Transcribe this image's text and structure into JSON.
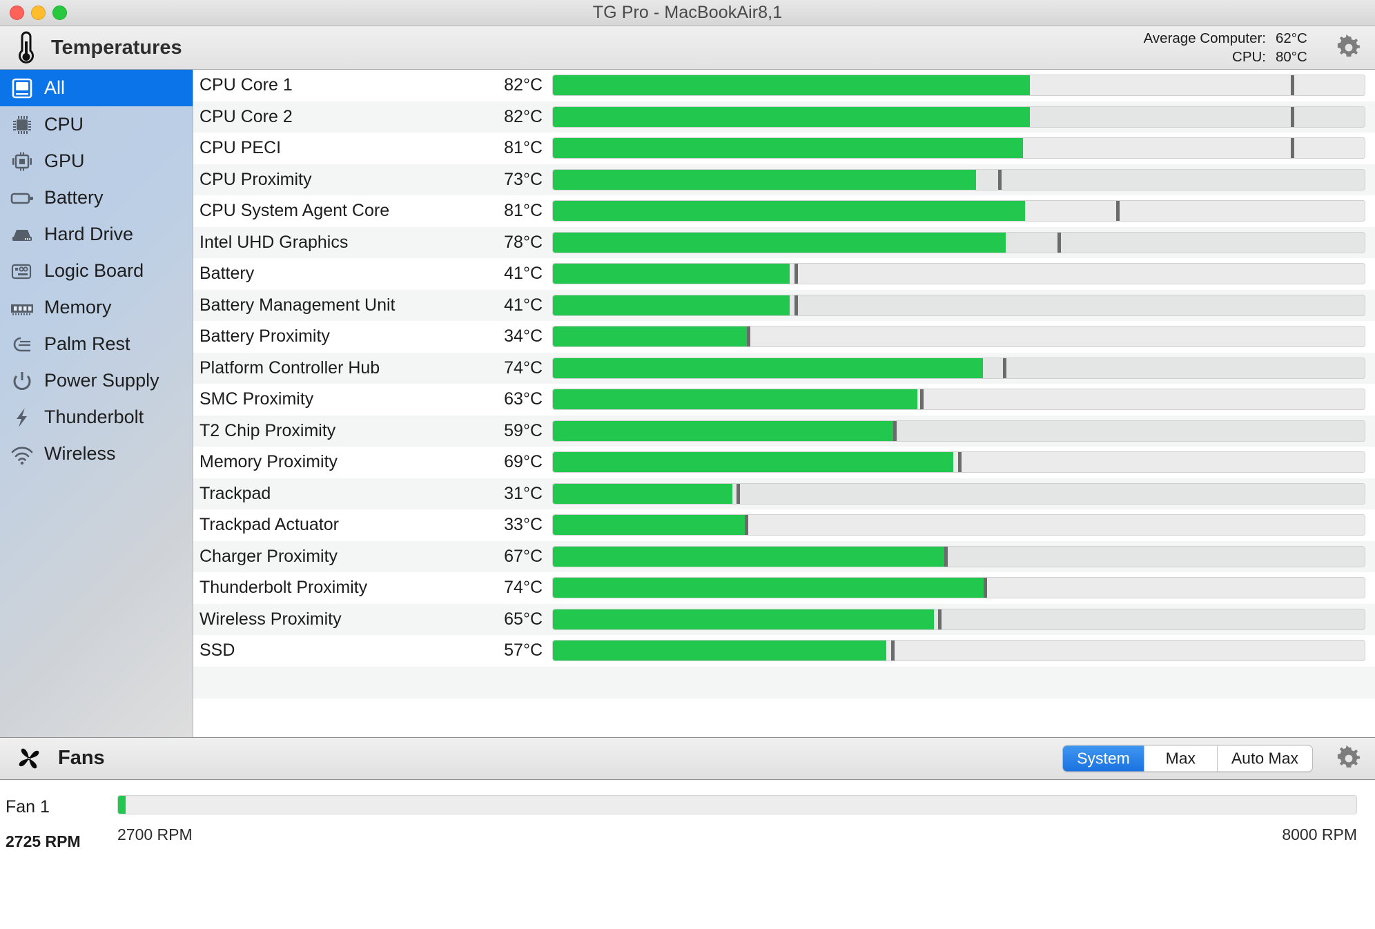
{
  "window": {
    "title": "TG Pro - MacBookAir8,1",
    "traffic_lights": [
      "close-button",
      "minimize-button",
      "zoom-button"
    ]
  },
  "temps_header": {
    "icon": "thermometer-icon",
    "title": "Temperatures",
    "summary": [
      {
        "label": "Average Computer:",
        "value": "62°C"
      },
      {
        "label": "CPU:",
        "value": "80°C"
      }
    ],
    "settings_icon": "gear-icon"
  },
  "sidebar": {
    "items": [
      {
        "label": "All",
        "icon": "computer-icon",
        "selected": true
      },
      {
        "label": "CPU",
        "icon": "cpu-chip-icon",
        "selected": false
      },
      {
        "label": "GPU",
        "icon": "gpu-chip-icon",
        "selected": false
      },
      {
        "label": "Battery",
        "icon": "battery-icon",
        "selected": false
      },
      {
        "label": "Hard Drive",
        "icon": "hard-drive-icon",
        "selected": false
      },
      {
        "label": "Logic Board",
        "icon": "logic-board-icon",
        "selected": false
      },
      {
        "label": "Memory",
        "icon": "memory-ram-icon",
        "selected": false
      },
      {
        "label": "Palm Rest",
        "icon": "palm-rest-icon",
        "selected": false
      },
      {
        "label": "Power Supply",
        "icon": "power-icon",
        "selected": false
      },
      {
        "label": "Thunderbolt",
        "icon": "lightning-bolt-icon",
        "selected": false
      },
      {
        "label": "Wireless",
        "icon": "wifi-icon",
        "selected": false
      }
    ]
  },
  "sensors": [
    {
      "name": "CPU Core 1",
      "value": "82°C",
      "temp": 82,
      "fill_pct": 58.8,
      "marker_pct": 91.1
    },
    {
      "name": "CPU Core 2",
      "value": "82°C",
      "temp": 82,
      "fill_pct": 58.8,
      "marker_pct": 91.1
    },
    {
      "name": "CPU PECI",
      "value": "81°C",
      "temp": 81,
      "fill_pct": 57.9,
      "marker_pct": 91.1
    },
    {
      "name": "CPU Proximity",
      "value": "73°C",
      "temp": 73,
      "fill_pct": 52.1,
      "marker_pct": 55.0
    },
    {
      "name": "CPU System Agent Core",
      "value": "81°C",
      "temp": 81,
      "fill_pct": 58.2,
      "marker_pct": 69.6
    },
    {
      "name": "Intel UHD Graphics",
      "value": "78°C",
      "temp": 78,
      "fill_pct": 55.8,
      "marker_pct": 62.3
    },
    {
      "name": "Battery",
      "value": "41°C",
      "temp": 41,
      "fill_pct": 29.2,
      "marker_pct": 29.9
    },
    {
      "name": "Battery Management Unit",
      "value": "41°C",
      "temp": 41,
      "fill_pct": 29.2,
      "marker_pct": 29.9
    },
    {
      "name": "Battery Proximity",
      "value": "34°C",
      "temp": 34,
      "fill_pct": 24.1,
      "marker_pct": 24.1
    },
    {
      "name": "Platform Controller Hub",
      "value": "74°C",
      "temp": 74,
      "fill_pct": 53.0,
      "marker_pct": 55.6
    },
    {
      "name": "SMC Proximity",
      "value": "63°C",
      "temp": 63,
      "fill_pct": 44.9,
      "marker_pct": 45.4
    },
    {
      "name": "T2 Chip Proximity",
      "value": "59°C",
      "temp": 59,
      "fill_pct": 42.1,
      "marker_pct": 42.1
    },
    {
      "name": "Memory Proximity",
      "value": "69°C",
      "temp": 69,
      "fill_pct": 49.3,
      "marker_pct": 50.1
    },
    {
      "name": "Trackpad",
      "value": "31°C",
      "temp": 31,
      "fill_pct": 22.1,
      "marker_pct": 22.8
    },
    {
      "name": "Trackpad Actuator",
      "value": "33°C",
      "temp": 33,
      "fill_pct": 23.7,
      "marker_pct": 23.8
    },
    {
      "name": "Charger Proximity",
      "value": "67°C",
      "temp": 67,
      "fill_pct": 48.4,
      "marker_pct": 48.4
    },
    {
      "name": "Thunderbolt Proximity",
      "value": "74°C",
      "temp": 74,
      "fill_pct": 53.2,
      "marker_pct": 53.2
    },
    {
      "name": "Wireless Proximity",
      "value": "65°C",
      "temp": 65,
      "fill_pct": 46.9,
      "marker_pct": 47.6
    },
    {
      "name": "SSD",
      "value": "57°C",
      "temp": 57,
      "fill_pct": 41.1,
      "marker_pct": 41.8
    }
  ],
  "fans_header": {
    "icon": "fan-icon",
    "title": "Fans",
    "modes": [
      {
        "label": "System",
        "active": true
      },
      {
        "label": "Max",
        "active": false
      },
      {
        "label": "Auto Max",
        "active": false
      }
    ],
    "settings_icon": "gear-icon"
  },
  "fans": [
    {
      "name": "Fan 1",
      "rpm_label": "2725 RPM",
      "min_label": "2700 RPM",
      "max_label": "8000 RPM",
      "fill_pct": 0.6
    }
  ],
  "colors": {
    "accent_blue": "#0a74e8",
    "bar_green": "#22c74e",
    "marker_gray": "#6b6b6b",
    "track_gray": "#ebebeb"
  }
}
